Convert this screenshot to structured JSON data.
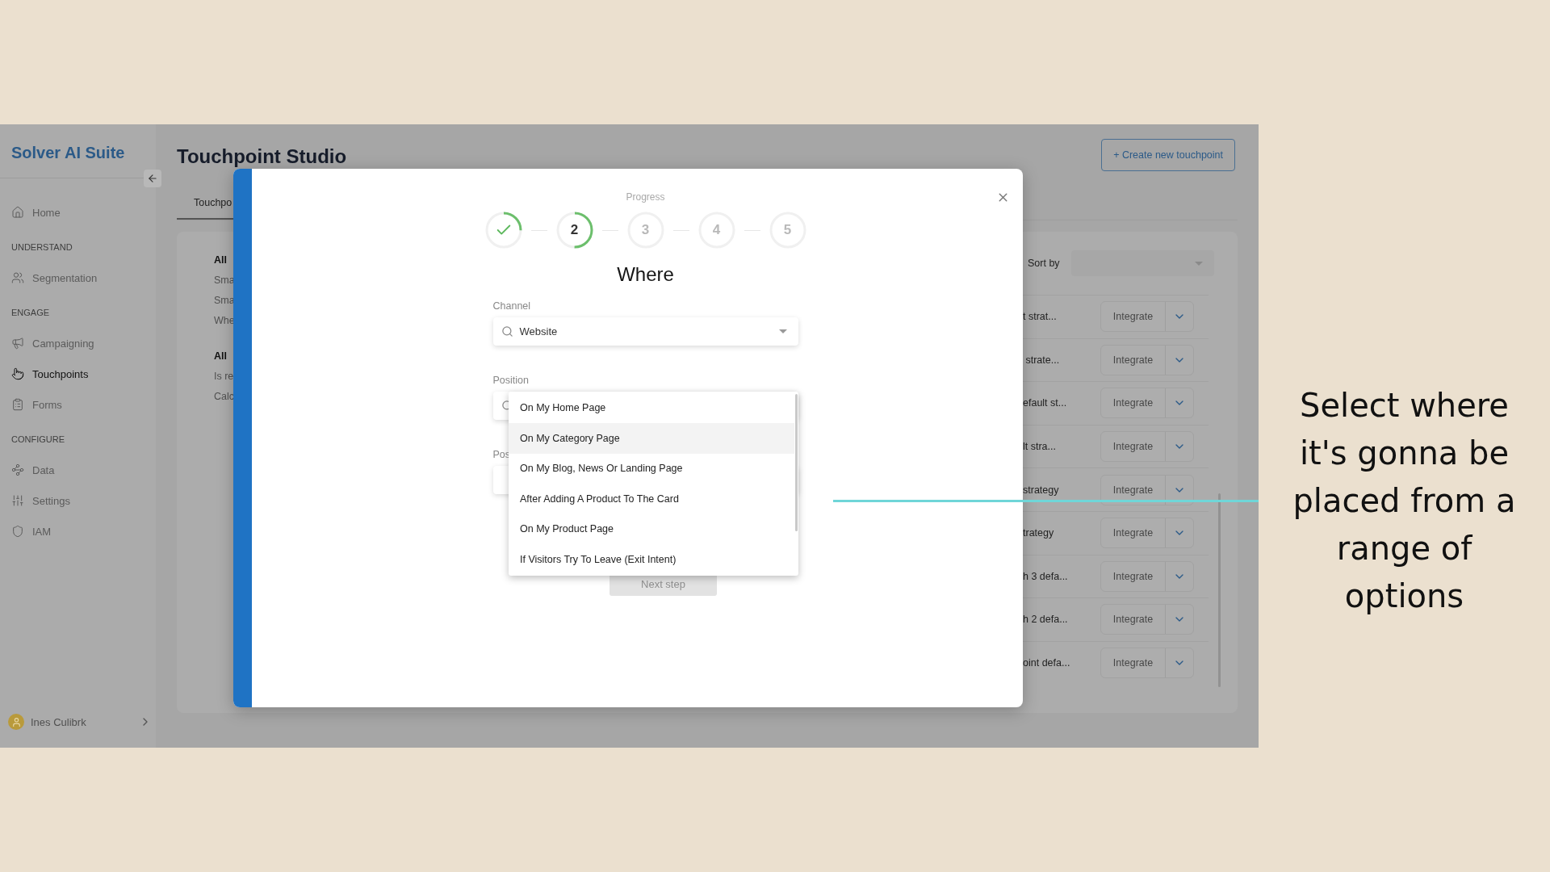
{
  "sidebar": {
    "logo": "Solver AI Suite",
    "groups": [
      {
        "items": [
          {
            "label": "Home",
            "selected": false
          }
        ]
      },
      {
        "heading": "UNDERSTAND",
        "items": [
          {
            "label": "Segmentation",
            "selected": false
          }
        ]
      },
      {
        "heading": "ENGAGE",
        "items": [
          {
            "label": "Campaigning",
            "selected": false
          },
          {
            "label": "Touchpoints",
            "selected": true
          },
          {
            "label": "Forms",
            "selected": false
          }
        ]
      },
      {
        "heading": "CONFIGURE",
        "items": [
          {
            "label": "Data",
            "selected": false
          },
          {
            "label": "Settings",
            "selected": false
          },
          {
            "label": "IAM",
            "selected": false
          }
        ]
      }
    ],
    "user": {
      "name": "Ines Culibrk"
    }
  },
  "page": {
    "title": "Touchpoint Studio",
    "create_button": "+ Create new touchpoint",
    "tabs": [
      {
        "label": "Touchpo",
        "selected": true
      }
    ]
  },
  "filters": [
    {
      "kind": "heading",
      "label": "All"
    },
    {
      "kind": "option",
      "label": "Sma"
    },
    {
      "kind": "option",
      "label": "Sma"
    },
    {
      "kind": "option",
      "label": "Whe"
    },
    {
      "kind": "heading",
      "label": "All"
    },
    {
      "kind": "option",
      "label": "Is re"
    },
    {
      "kind": "option",
      "label": "Calc"
    }
  ],
  "sort": {
    "label": "Sort by"
  },
  "rows": [
    {
      "name": "t strat...",
      "action": "Integrate"
    },
    {
      "name": " strate...",
      "action": "Integrate"
    },
    {
      "name": "efault st...",
      "action": "Integrate"
    },
    {
      "name": "lt stra...",
      "action": "Integrate"
    },
    {
      "name": "strategy",
      "action": "Integrate"
    },
    {
      "name": "trategy",
      "action": "Integrate"
    },
    {
      "name": "h 3 defa...",
      "action": "Integrate"
    },
    {
      "name": "h 2 defa...",
      "action": "Integrate"
    },
    {
      "name": "oint defa...",
      "action": "Integrate"
    }
  ],
  "modal": {
    "progress_label": "Progress",
    "steps": [
      {
        "done": true,
        "current": false
      },
      {
        "label": "2",
        "done": false,
        "current": true
      },
      {
        "label": "3",
        "done": false,
        "current": false
      },
      {
        "label": "4",
        "done": false,
        "current": false
      },
      {
        "label": "5",
        "done": false,
        "current": false
      }
    ],
    "title": "Where",
    "fields": [
      {
        "label": "Channel",
        "value": "Website"
      },
      {
        "label": "Position"
      },
      {
        "label": "Pos"
      }
    ],
    "options": [
      {
        "label": "On My Home Page",
        "selected": false
      },
      {
        "label": "On My Category Page",
        "selected": true
      },
      {
        "label": "On My Blog, News Or Landing Page",
        "selected": false
      },
      {
        "label": "After Adding A Product To The Card",
        "selected": false
      },
      {
        "label": "On My Product Page",
        "selected": false
      },
      {
        "label": "If Visitors Try To Leave (Exit Intent)",
        "selected": false
      }
    ],
    "next_button": {
      "label": "Next step",
      "disabled": true
    }
  },
  "annotation": {
    "text": "Select where it's gonna be placed from a range of options"
  }
}
